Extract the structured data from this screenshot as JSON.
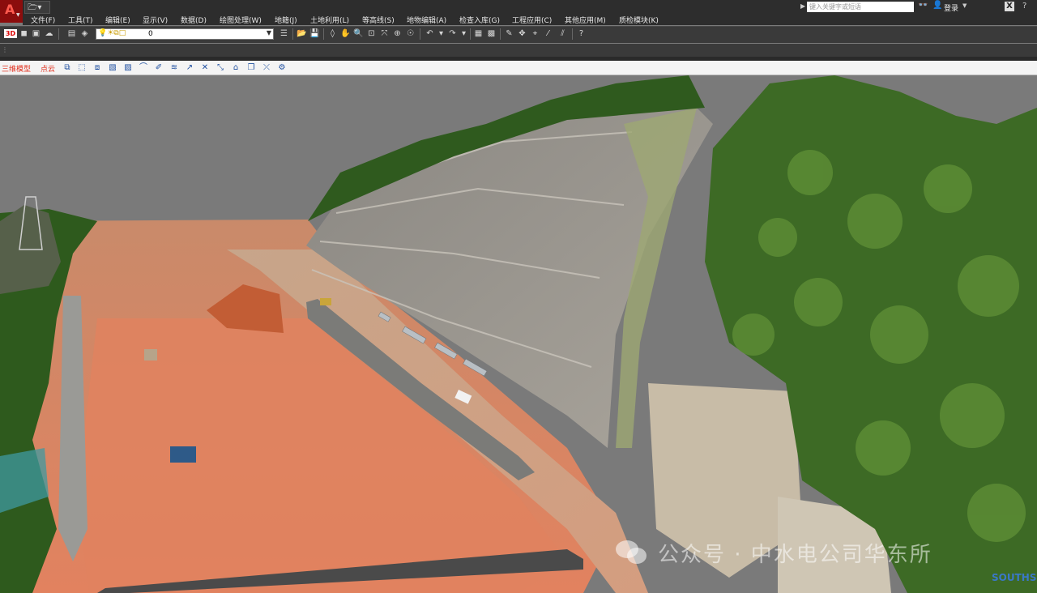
{
  "titlebar": {
    "search_placeholder": "键入关键字或短语",
    "login_label": "登录"
  },
  "menu": [
    {
      "label": "文件(F)"
    },
    {
      "label": "工具(T)"
    },
    {
      "label": "编辑(E)"
    },
    {
      "label": "显示(V)"
    },
    {
      "label": "数据(D)"
    },
    {
      "label": "绘图处理(W)"
    },
    {
      "label": "地籍(J)"
    },
    {
      "label": "土地利用(L)"
    },
    {
      "label": "等高线(S)"
    },
    {
      "label": "地物编辑(A)"
    },
    {
      "label": "检查入库(G)"
    },
    {
      "label": "工程应用(C)"
    },
    {
      "label": "其他应用(M)"
    },
    {
      "label": "质检模块(K)"
    }
  ],
  "toolbar1": {
    "view_3d_label": "3D",
    "layer_value": "0"
  },
  "toolbar3": {
    "model_label": "三维模型",
    "pointcloud_label": "点云"
  },
  "viewport": {
    "watermark_text": "公众号 · 中水电公司华东所",
    "corner_logo": "SOUTHS"
  },
  "colors": {
    "chrome_dark": "#2d2d2d",
    "toolbar": "#3a3a3a",
    "sky": "#7a7a7a",
    "soil": "#d9825e",
    "slope": "#9a9690",
    "vegetation": "#3f6b27"
  }
}
